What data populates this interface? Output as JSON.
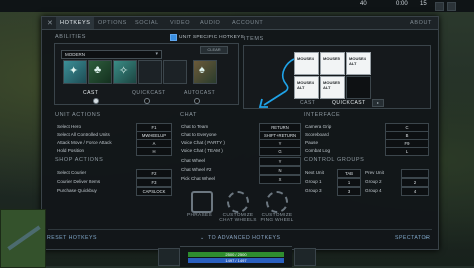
{
  "topbar": {
    "gold": "40",
    "time": "0:00",
    "extra": "15"
  },
  "tabs": [
    {
      "label": "HOTKEYS",
      "active": true
    },
    {
      "label": "OPTIONS",
      "active": false
    },
    {
      "label": "SOCIAL",
      "active": false
    },
    {
      "label": "VIDEO",
      "active": false
    },
    {
      "label": "AUDIO",
      "active": false
    },
    {
      "label": "ACCOUNT",
      "active": false
    }
  ],
  "about_label": "ABOUT",
  "abilities": {
    "title": "ABILITIES",
    "hero_dropdown": "MODERN",
    "unit_specific_label": "UNIT SPECIFIC HOTKEYS",
    "clear_label": "CLEAR",
    "cast_modes": [
      "CAST",
      "QUICKCAST",
      "AUTOCAST"
    ]
  },
  "items": {
    "title": "ITEMS",
    "slots": [
      {
        "line1": "MOUSE4",
        "line2": "",
        "highlighted": true
      },
      {
        "line1": "MOUSE5",
        "line2": "",
        "highlighted": false
      },
      {
        "line1": "MOUSE4",
        "line2": "ALT",
        "highlighted": false
      },
      {
        "line1": "MOUSE4",
        "line2": "ALT",
        "highlighted": true
      },
      {
        "line1": "MOUSE5",
        "line2": "ALT",
        "highlighted": false
      },
      {
        "line1": "",
        "line2": "",
        "highlighted": false
      }
    ],
    "cast_label": "CAST",
    "quickcast_label": "QUICKCAST"
  },
  "unit_actions": {
    "title": "UNIT ACTIONS",
    "rows": [
      {
        "name": "Select Hero",
        "key": "F1"
      },
      {
        "name": "Select All Controlled Units",
        "key": "MWHEELUP"
      },
      {
        "name": "Attack Move / Force Attack",
        "key": "A"
      },
      {
        "name": "Hold Position",
        "key": "H"
      }
    ]
  },
  "shop_actions": {
    "title": "SHOP ACTIONS",
    "rows": [
      {
        "name": "Select Courier",
        "key": "F2"
      },
      {
        "name": "Courier Deliver Items",
        "key": "F3"
      },
      {
        "name": "Purchase Quickbuy",
        "key": "CAPSLOCK"
      }
    ]
  },
  "chat": {
    "title": "CHAT",
    "rows": [
      {
        "name": "Chat to Team",
        "key": "RETURN"
      },
      {
        "name": "Chat to Everyone",
        "key": "SHIFT+RETURN"
      },
      {
        "name": "Voice Chat ( PARTY )",
        "key": "Y"
      },
      {
        "name": "Voice Chat ( TEAM )",
        "key": "G"
      },
      {
        "name": "Chat Wheel",
        "key": "Y"
      },
      {
        "name": "Chat Wheel #2",
        "key": "N"
      },
      {
        "name": "Pick Chat Wheel",
        "key": "X"
      }
    ]
  },
  "interface": {
    "title": "INTERFACE",
    "rows": [
      {
        "name": "Camera Grip",
        "key": "C"
      },
      {
        "name": "Scoreboard",
        "key": "B"
      },
      {
        "name": "Pause",
        "key": "F9"
      },
      {
        "name": "Combat Log",
        "key": "L"
      }
    ]
  },
  "control_groups": {
    "title": "CONTROL GROUPS",
    "rows": [
      {
        "name": "Next Unit",
        "key": "TAB",
        "name2": "Prev Unit",
        "key2": ""
      },
      {
        "name": "Group 1",
        "key": "1",
        "name2": "Group 2",
        "key2": "2"
      },
      {
        "name": "Group 3",
        "key": "3",
        "name2": "Group 4",
        "key2": "4"
      }
    ]
  },
  "wheels": {
    "phrases_label": "PHRASES",
    "chat_wheels_label": "CUSTOMIZE CHAT WHEELS",
    "ping_wheel_label": "CUSTOMIZE PING WHEEL"
  },
  "footer": {
    "reset_label": "RESET HOTKEYS",
    "advanced_label": "TO ADVANCED HOTKEYS",
    "spectator_label": "SPECTATOR"
  },
  "hud": {
    "hp": "2500 / 2500",
    "mp": "1497 / 1497"
  },
  "colors": {
    "accent": "#3a8ee0",
    "panel": "#121619"
  }
}
